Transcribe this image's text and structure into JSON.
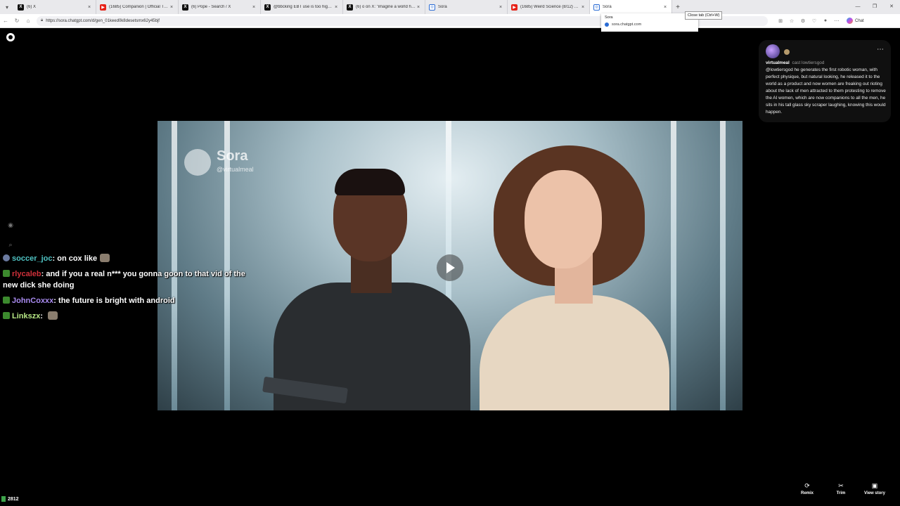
{
  "browser": {
    "tabs": [
      {
        "favicon": "x-icon",
        "title": "(6) X",
        "active": false
      },
      {
        "favicon": "youtube-icon",
        "title": "(1685) Companion | Official Trailer",
        "active": false
      },
      {
        "favicon": "x-icon",
        "title": "(6) Pope - Search / X",
        "active": false
      },
      {
        "favicon": "x-icon",
        "title": "@bbcking EBT use is too high, a...",
        "active": false
      },
      {
        "favicon": "x-icon",
        "title": "(6) o on X: \"imagine a world https...",
        "active": false
      },
      {
        "favicon": "sora-icon",
        "title": "Sora",
        "active": false
      },
      {
        "favicon": "youtube-icon",
        "title": "(1685) Weird Science (8/12) Movie...",
        "active": false
      },
      {
        "favicon": "sora-icon",
        "title": "Sora",
        "active": true
      }
    ],
    "address": "https://sora.chatgpt.com/d/gen_01keed0k8desetsmx62y45bjf",
    "tooltip": "Close tab (Ctrl+W)",
    "hovercard": {
      "title": "Sora",
      "site": "sora.chatgpt.com"
    },
    "copilot_label": "Chat"
  },
  "video": {
    "watermark_brand": "Sora",
    "watermark_handle": "@virtualmeal"
  },
  "chat": [
    {
      "user": "soccer_joc",
      "user_color": "#4fc3c3",
      "message": "on cox like"
    },
    {
      "user": "rlycaleb",
      "user_color": "#d0303a",
      "message": "and if you a real n*** you gonna goon to that vid of the new dick she doing"
    },
    {
      "user": "JohnCoxxx",
      "user_color": "#a98bf0",
      "message": "the future is bright with android"
    },
    {
      "user": "Linkszx",
      "user_color": "#b8e986",
      "message": ""
    }
  ],
  "comment": {
    "username": "virtualmeal",
    "cast_prefix": "cast",
    "cast_user": "lowtiersgod",
    "text": "@lowtiersgod he generates the first robotic woman, with perfect physique, but natural looking, he released it to the world as a product and now women are freaking out rioting about the lack of men attracted to them protesting to remove the AI women, which are now companions to all the men, he sits in his tall glass sky scraper laughing, knowing this would happen."
  },
  "actions": {
    "remix": "Remix",
    "trim": "Trim",
    "view_story": "View story"
  },
  "viewer_count": "2812",
  "colors": {
    "background": "#000000",
    "tab_strip": "#e9e9ec"
  }
}
